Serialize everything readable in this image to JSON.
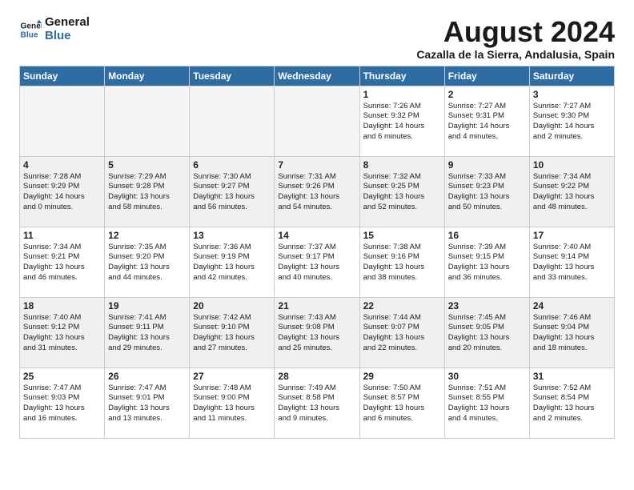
{
  "logo": {
    "line1": "General",
    "line2": "Blue"
  },
  "title": "August 2024",
  "location": "Cazalla de la Sierra, Andalusia, Spain",
  "days_of_week": [
    "Sunday",
    "Monday",
    "Tuesday",
    "Wednesday",
    "Thursday",
    "Friday",
    "Saturday"
  ],
  "weeks": [
    [
      {
        "day": "",
        "empty": true
      },
      {
        "day": "",
        "empty": true
      },
      {
        "day": "",
        "empty": true
      },
      {
        "day": "",
        "empty": true
      },
      {
        "day": "1",
        "info": "Sunrise: 7:26 AM\nSunset: 9:32 PM\nDaylight: 14 hours\nand 6 minutes."
      },
      {
        "day": "2",
        "info": "Sunrise: 7:27 AM\nSunset: 9:31 PM\nDaylight: 14 hours\nand 4 minutes."
      },
      {
        "day": "3",
        "info": "Sunrise: 7:27 AM\nSunset: 9:30 PM\nDaylight: 14 hours\nand 2 minutes."
      }
    ],
    [
      {
        "day": "4",
        "info": "Sunrise: 7:28 AM\nSunset: 9:29 PM\nDaylight: 14 hours\nand 0 minutes.",
        "shaded": true
      },
      {
        "day": "5",
        "info": "Sunrise: 7:29 AM\nSunset: 9:28 PM\nDaylight: 13 hours\nand 58 minutes.",
        "shaded": true
      },
      {
        "day": "6",
        "info": "Sunrise: 7:30 AM\nSunset: 9:27 PM\nDaylight: 13 hours\nand 56 minutes.",
        "shaded": true
      },
      {
        "day": "7",
        "info": "Sunrise: 7:31 AM\nSunset: 9:26 PM\nDaylight: 13 hours\nand 54 minutes.",
        "shaded": true
      },
      {
        "day": "8",
        "info": "Sunrise: 7:32 AM\nSunset: 9:25 PM\nDaylight: 13 hours\nand 52 minutes.",
        "shaded": true
      },
      {
        "day": "9",
        "info": "Sunrise: 7:33 AM\nSunset: 9:23 PM\nDaylight: 13 hours\nand 50 minutes.",
        "shaded": true
      },
      {
        "day": "10",
        "info": "Sunrise: 7:34 AM\nSunset: 9:22 PM\nDaylight: 13 hours\nand 48 minutes.",
        "shaded": true
      }
    ],
    [
      {
        "day": "11",
        "info": "Sunrise: 7:34 AM\nSunset: 9:21 PM\nDaylight: 13 hours\nand 46 minutes."
      },
      {
        "day": "12",
        "info": "Sunrise: 7:35 AM\nSunset: 9:20 PM\nDaylight: 13 hours\nand 44 minutes."
      },
      {
        "day": "13",
        "info": "Sunrise: 7:36 AM\nSunset: 9:19 PM\nDaylight: 13 hours\nand 42 minutes."
      },
      {
        "day": "14",
        "info": "Sunrise: 7:37 AM\nSunset: 9:17 PM\nDaylight: 13 hours\nand 40 minutes."
      },
      {
        "day": "15",
        "info": "Sunrise: 7:38 AM\nSunset: 9:16 PM\nDaylight: 13 hours\nand 38 minutes."
      },
      {
        "day": "16",
        "info": "Sunrise: 7:39 AM\nSunset: 9:15 PM\nDaylight: 13 hours\nand 36 minutes."
      },
      {
        "day": "17",
        "info": "Sunrise: 7:40 AM\nSunset: 9:14 PM\nDaylight: 13 hours\nand 33 minutes."
      }
    ],
    [
      {
        "day": "18",
        "info": "Sunrise: 7:40 AM\nSunset: 9:12 PM\nDaylight: 13 hours\nand 31 minutes.",
        "shaded": true
      },
      {
        "day": "19",
        "info": "Sunrise: 7:41 AM\nSunset: 9:11 PM\nDaylight: 13 hours\nand 29 minutes.",
        "shaded": true
      },
      {
        "day": "20",
        "info": "Sunrise: 7:42 AM\nSunset: 9:10 PM\nDaylight: 13 hours\nand 27 minutes.",
        "shaded": true
      },
      {
        "day": "21",
        "info": "Sunrise: 7:43 AM\nSunset: 9:08 PM\nDaylight: 13 hours\nand 25 minutes.",
        "shaded": true
      },
      {
        "day": "22",
        "info": "Sunrise: 7:44 AM\nSunset: 9:07 PM\nDaylight: 13 hours\nand 22 minutes.",
        "shaded": true
      },
      {
        "day": "23",
        "info": "Sunrise: 7:45 AM\nSunset: 9:05 PM\nDaylight: 13 hours\nand 20 minutes.",
        "shaded": true
      },
      {
        "day": "24",
        "info": "Sunrise: 7:46 AM\nSunset: 9:04 PM\nDaylight: 13 hours\nand 18 minutes.",
        "shaded": true
      }
    ],
    [
      {
        "day": "25",
        "info": "Sunrise: 7:47 AM\nSunset: 9:03 PM\nDaylight: 13 hours\nand 16 minutes."
      },
      {
        "day": "26",
        "info": "Sunrise: 7:47 AM\nSunset: 9:01 PM\nDaylight: 13 hours\nand 13 minutes."
      },
      {
        "day": "27",
        "info": "Sunrise: 7:48 AM\nSunset: 9:00 PM\nDaylight: 13 hours\nand 11 minutes."
      },
      {
        "day": "28",
        "info": "Sunrise: 7:49 AM\nSunset: 8:58 PM\nDaylight: 13 hours\nand 9 minutes."
      },
      {
        "day": "29",
        "info": "Sunrise: 7:50 AM\nSunset: 8:57 PM\nDaylight: 13 hours\nand 6 minutes."
      },
      {
        "day": "30",
        "info": "Sunrise: 7:51 AM\nSunset: 8:55 PM\nDaylight: 13 hours\nand 4 minutes."
      },
      {
        "day": "31",
        "info": "Sunrise: 7:52 AM\nSunset: 8:54 PM\nDaylight: 13 hours\nand 2 minutes."
      }
    ]
  ]
}
